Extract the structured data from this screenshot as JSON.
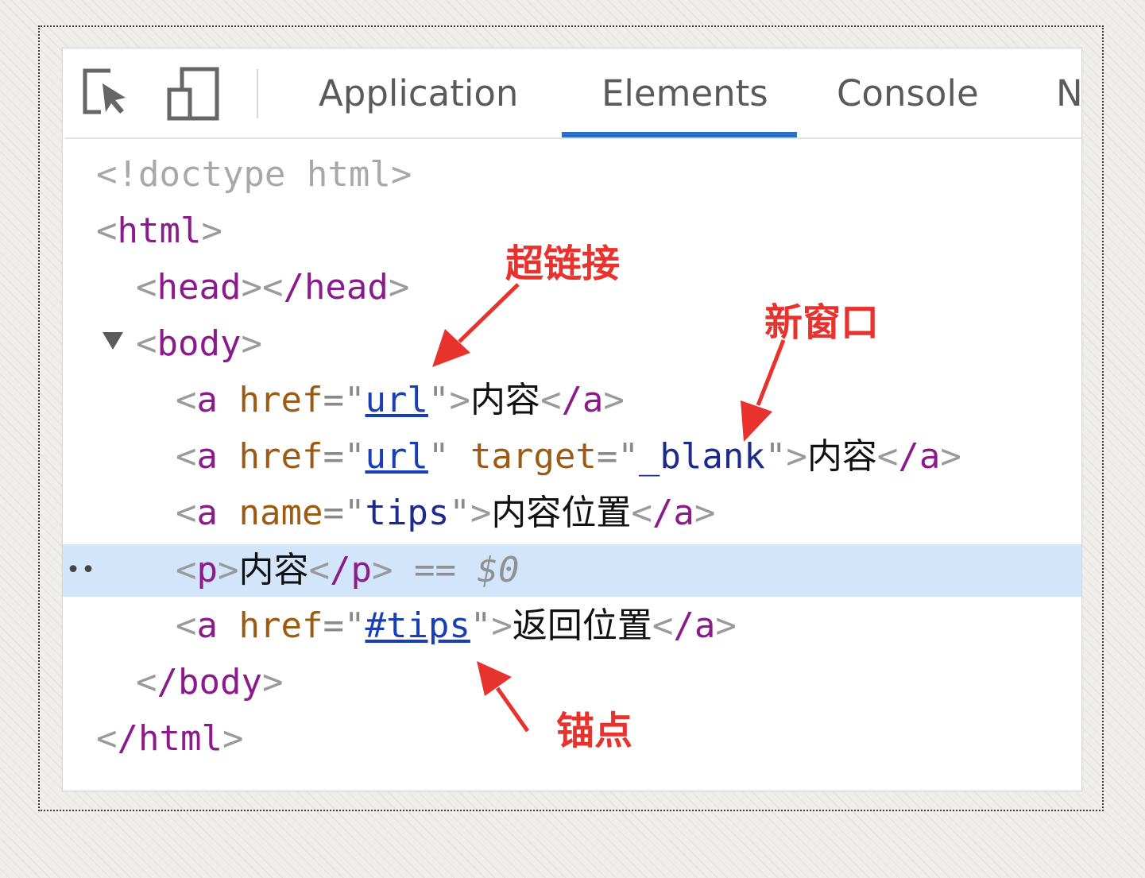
{
  "toolbar": {
    "icons": [
      "inspect-element-icon",
      "device-toolbar-icon"
    ],
    "tabs": [
      {
        "label": "Application",
        "active": false
      },
      {
        "label": "Elements",
        "active": true
      },
      {
        "label": "Console",
        "active": false
      },
      {
        "label": "N",
        "active": false
      }
    ]
  },
  "dom": {
    "doctype": "<!doctype html>",
    "html_open": "html",
    "head_open": "head",
    "head_close": "/head",
    "body_open": "body",
    "a1": {
      "tag": "a",
      "attr": "href",
      "value": "url",
      "text": "内容",
      "close": "/a"
    },
    "a2": {
      "tag": "a",
      "attr": "href",
      "value": "url",
      "attr2": "target",
      "value2": "_blank",
      "text": "内容",
      "close": "/a"
    },
    "a3": {
      "tag": "a",
      "attr": "name",
      "value": "tips",
      "text": "内容位置",
      "close": "/a"
    },
    "p": {
      "tag": "p",
      "text": "内容",
      "close": "/p",
      "marker": "== $0",
      "gutter": "••"
    },
    "a4": {
      "tag": "a",
      "attr": "href",
      "value": "#tips",
      "text": "返回位置",
      "close": "/a"
    },
    "body_close": "/body",
    "html_close": "/html"
  },
  "annotations": {
    "hyperlink": "超链接",
    "new_window": "新窗口",
    "anchor": "锚点",
    "color": "#e8322d"
  },
  "colors": {
    "tab_active_underline": "#2a6fc9",
    "selected_row": "#d3e5fb",
    "tag": "#8b1a8b",
    "attribute": "#9c5a12",
    "value": "#1c2a8c"
  }
}
